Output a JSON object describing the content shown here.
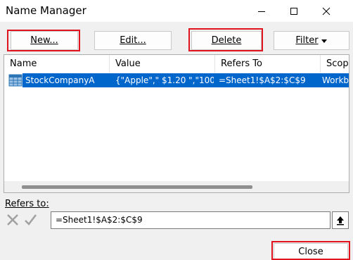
{
  "window": {
    "title": "Name Manager"
  },
  "toolbar": {
    "new_label": "New...",
    "edit_label": "Edit...",
    "delete_label": "Delete",
    "filter_label": "Filter"
  },
  "list": {
    "columns": [
      "Name",
      "Value",
      "Refers To",
      "Scope"
    ],
    "rows": [
      {
        "name": "StockCompanyA",
        "value": "{\"Apple\",\" $1.20 \",\"100...",
        "refers_to": "=Sheet1!$A$2:$C$9",
        "scope": "Workbook"
      }
    ]
  },
  "refers_to": {
    "label": "Refers to:",
    "value": "=Sheet1!$A$2:$C$9"
  },
  "footer": {
    "close_label": "Close"
  },
  "colors": {
    "selection": "#0066cc",
    "highlight_box": "#e0141e",
    "dialog_bg": "#f0f0f0"
  }
}
